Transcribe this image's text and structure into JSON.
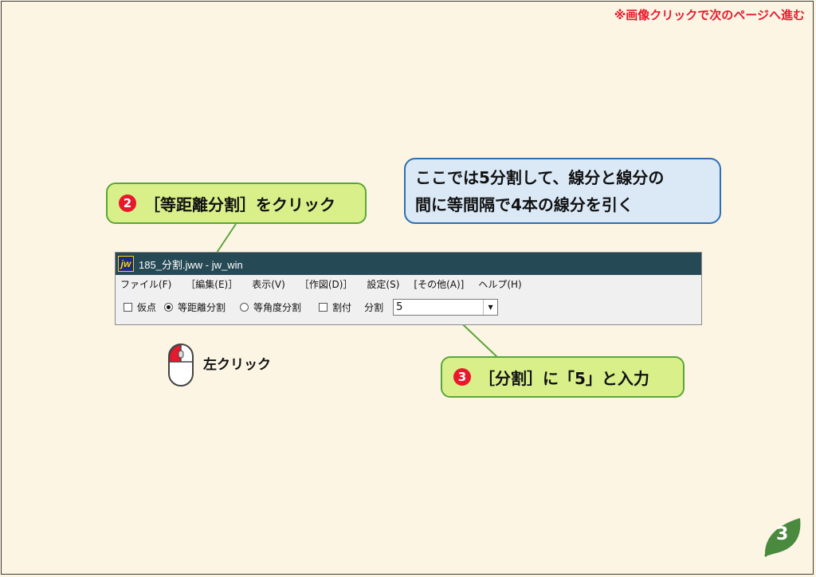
{
  "top_note": "※画像クリックで次のページへ進む",
  "callout_step2": {
    "number": "2",
    "text": "［等距離分割］をクリック"
  },
  "callout_info": {
    "line1": "ここでは5分割して、線分と線分の",
    "line2": "間に等間隔で4本の線分を引く"
  },
  "callout_step3": {
    "number": "3",
    "text": "［分割］に「5」と入力"
  },
  "mouse_label": "左クリック",
  "window": {
    "icon_text": "jw",
    "title": "185_分割.jww - jw_win",
    "menu": [
      "ファイル(F)",
      "［編集(E)］",
      "表示(V)",
      "［作図(D)］",
      "設定(S)",
      "[その他(A)]",
      "ヘルプ(H)"
    ],
    "toolbar": {
      "temporary_point": "仮点",
      "equal_distance": "等距離分割",
      "equal_angle": "等角度分割",
      "split_attach": "割付",
      "division_label": "分割",
      "division_value": "5"
    }
  },
  "page_number": "3",
  "colors": {
    "accent_red": "#e8192c",
    "green_callout": "#d9f08a",
    "blue_callout": "#dbe9f7",
    "titlebar": "#264a55"
  }
}
